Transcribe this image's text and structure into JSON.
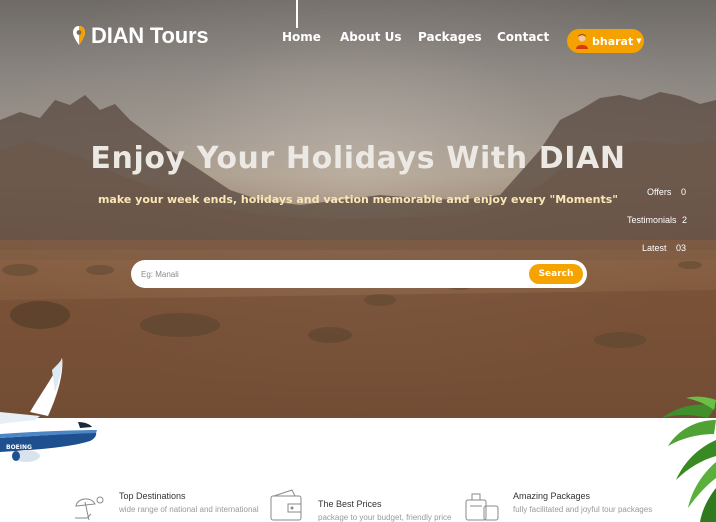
{
  "brand": {
    "name": "DIAN Tours"
  },
  "nav": {
    "items": [
      "Home",
      "About Us",
      "Packages",
      "Contact"
    ]
  },
  "user": {
    "name": "bharat"
  },
  "hero": {
    "title": "Enjoy Your Holidays With DIAN",
    "subtitle": "make your week ends, holidays and vaction memorable and enjoy every \"Moments\""
  },
  "stats": [
    {
      "label": "Offers",
      "value": "0"
    },
    {
      "label": "Testimonials",
      "value": "2"
    },
    {
      "label": "Latest",
      "value": "03"
    }
  ],
  "search": {
    "placeholder": "Eg: Manali",
    "button": "Search"
  },
  "features": [
    {
      "title": "Top Destinations",
      "desc": "wide range of national and international",
      "icon": "beach-umbrella-icon"
    },
    {
      "title": "The Best Prices",
      "desc": "package to your budget, friendly price",
      "icon": "wallet-icon"
    },
    {
      "title": "Amazing Packages",
      "desc": "fully facilitated and joyful tour packages",
      "icon": "luggage-icon"
    }
  ],
  "colors": {
    "accent": "#f5a100",
    "subtitle": "#fbe7b6"
  }
}
